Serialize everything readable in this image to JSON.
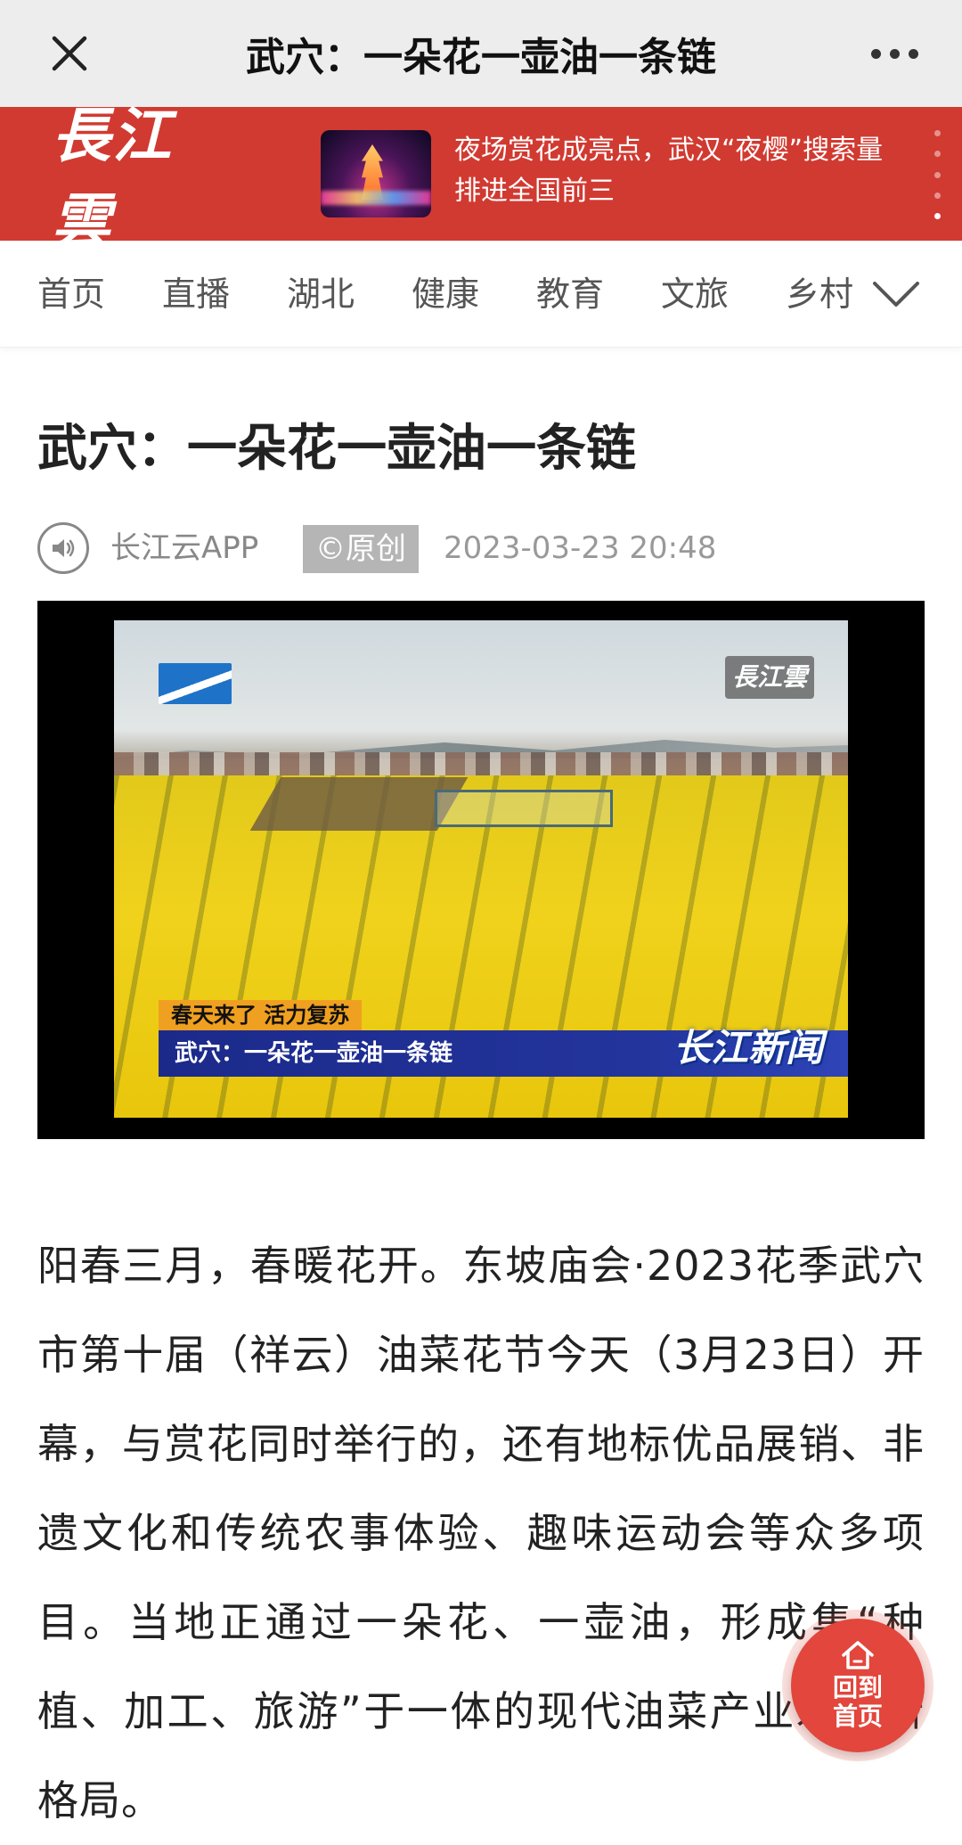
{
  "titlebar": {
    "title": "武穴：一朵花一壶油一条链",
    "close_icon": "close-icon",
    "more_icon": "more-icon"
  },
  "banner": {
    "logo_text": "長江雲",
    "headline": "夜场赏花成亮点，武汉“夜樱”搜索量排进全国前三",
    "colors": {
      "background": "#d13a31"
    }
  },
  "nav": {
    "items": [
      "首页",
      "直播",
      "湖北",
      "健康",
      "教育",
      "文旅",
      "乡村"
    ],
    "expand_icon": "chevron-down-icon"
  },
  "article": {
    "title": "武穴：一朵花一壶油一条链",
    "source": "长江云APP",
    "badge": "©原创",
    "time": "2023-03-23 20:48",
    "video": {
      "watermark": "長江雲",
      "lower_tag": "春天来了 活力复苏",
      "lower_title": "武穴：一朵花一壶油一条链",
      "news_logo": "长江新闻"
    },
    "body": "阳春三月，春暖花开。东坡庙会·2023花季武穴市第十届（祥云）油菜花节今天（3月23日）开幕，与赏花同时举行的，还有地标优品展销、非遗文化和传统农事体验、趣味运动会等众多项目。当地正通过一朵花、一壶油，形成集“种植、加工、旅游”于一体的现代油菜产业发展新格局。"
  },
  "home_button": {
    "label": "回到首页",
    "icon": "home-icon",
    "color": "#e2463c"
  }
}
